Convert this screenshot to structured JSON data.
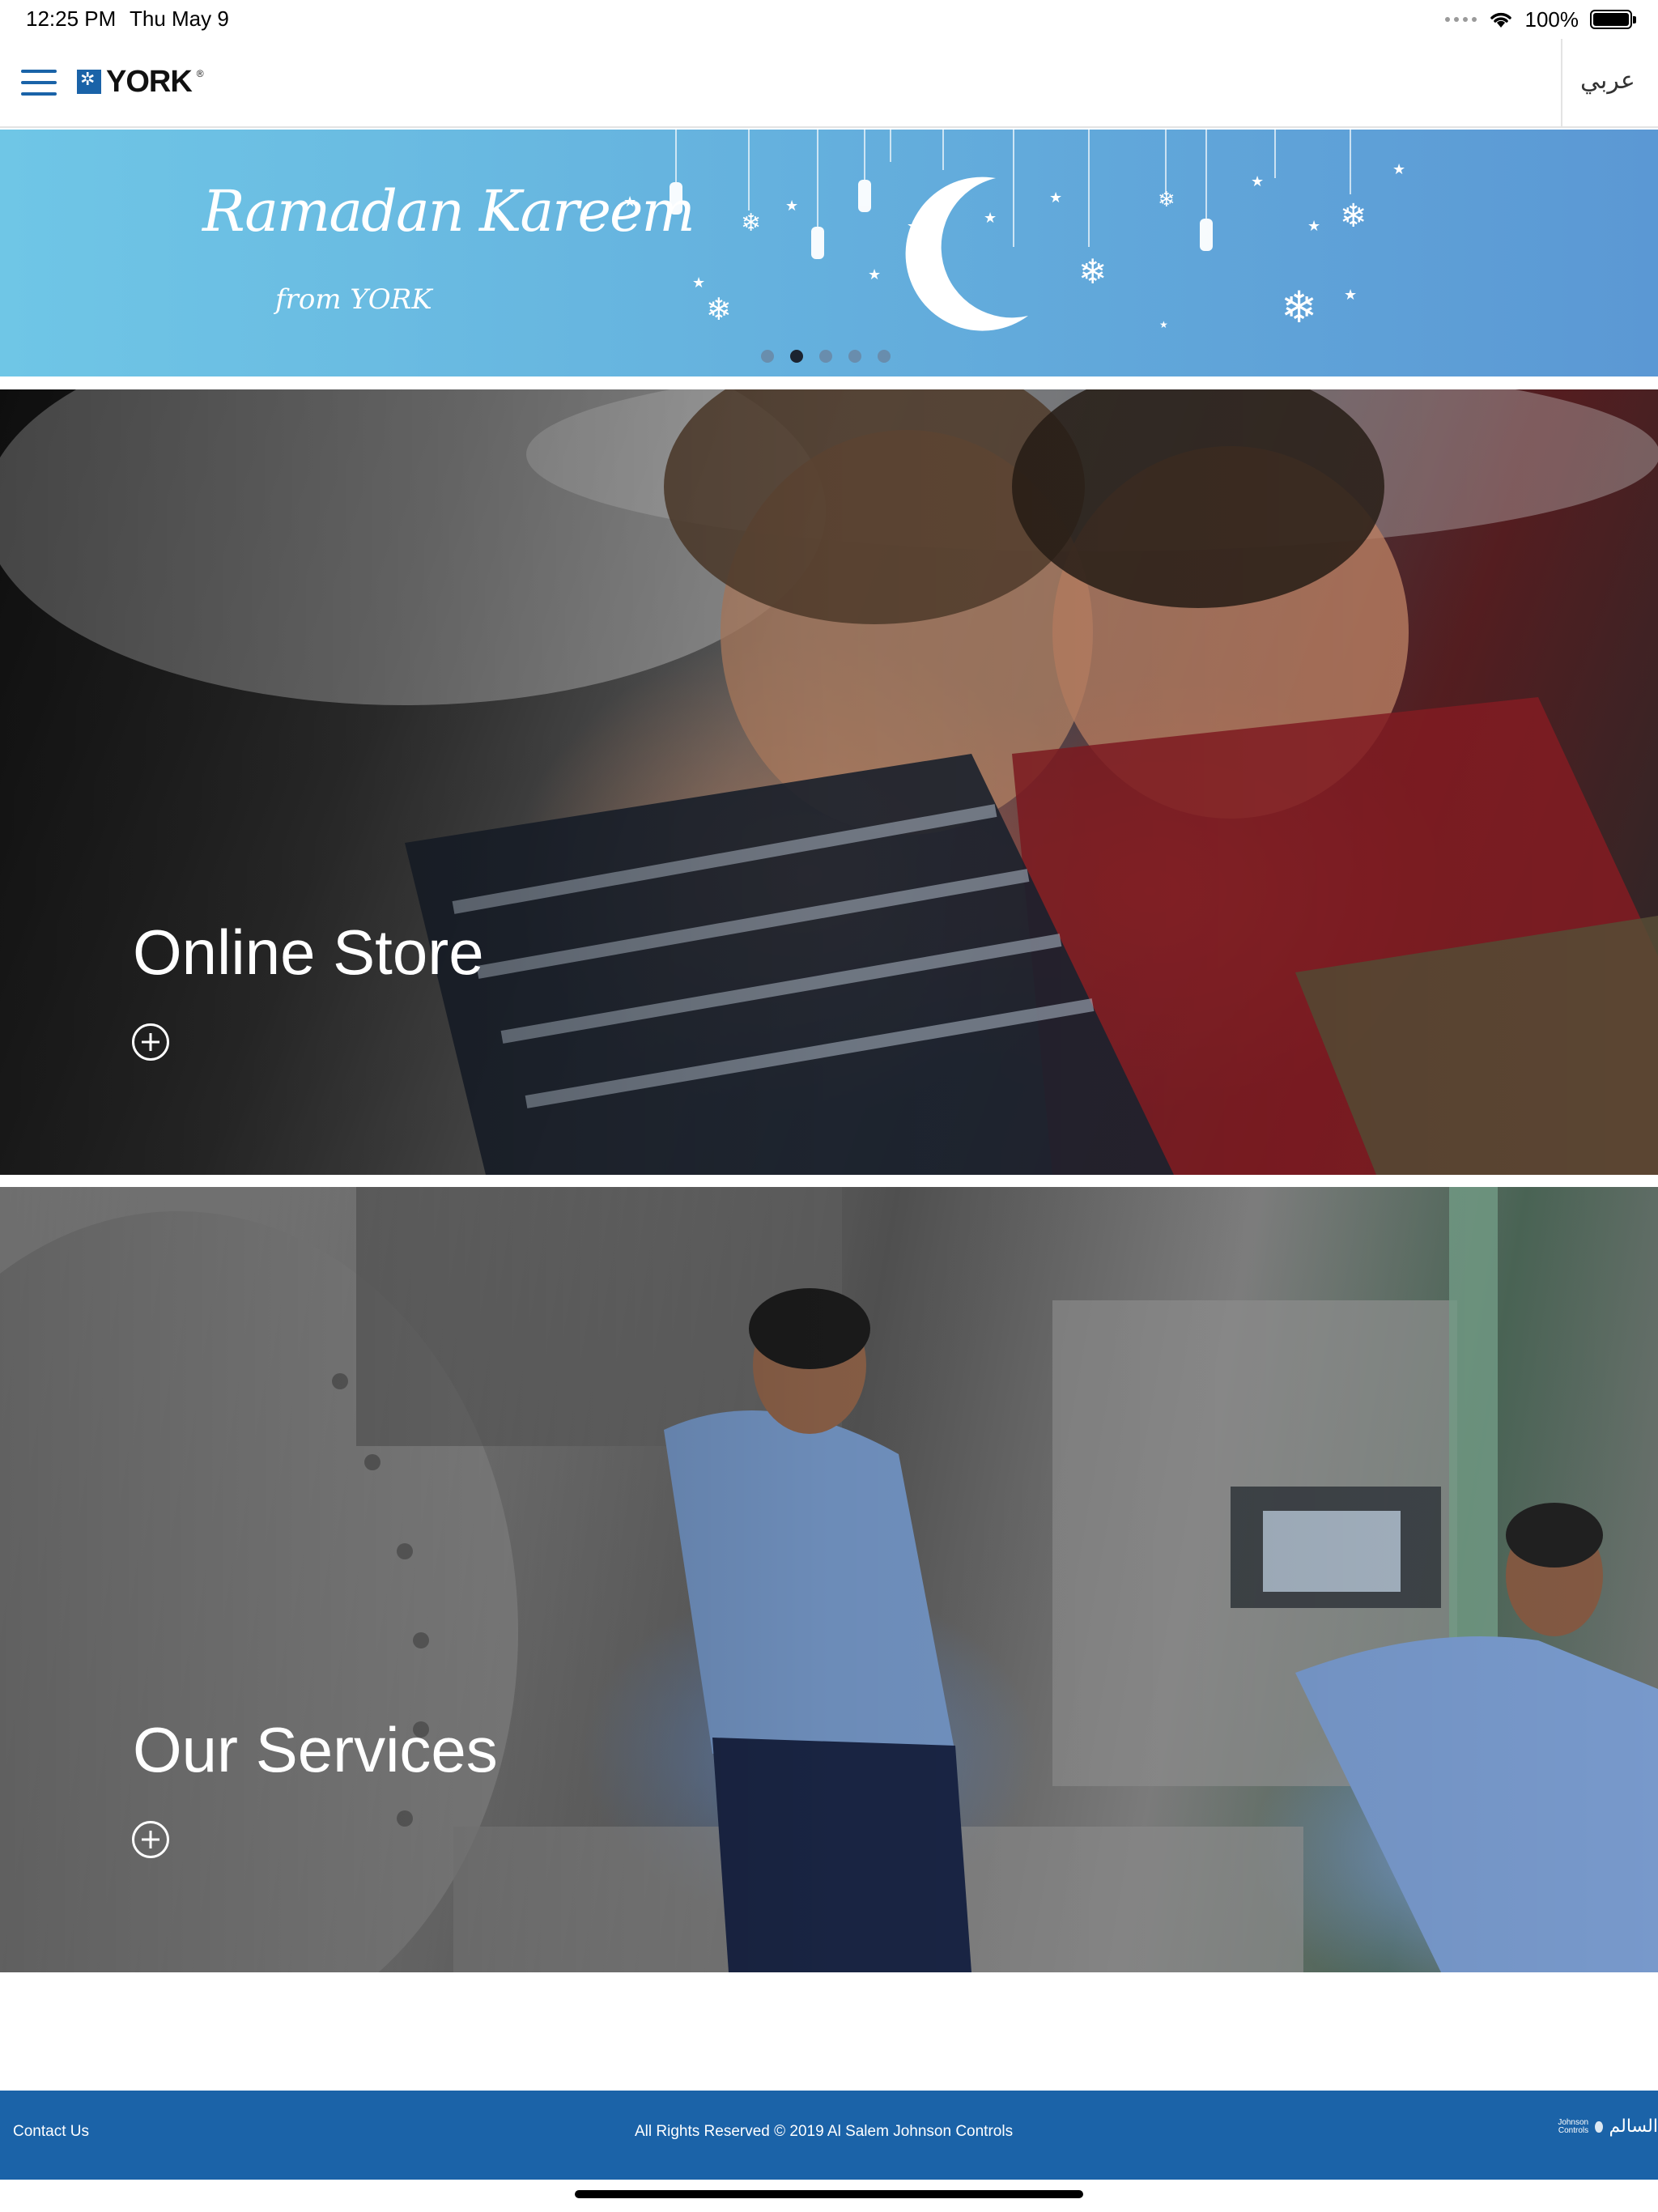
{
  "status_bar": {
    "time": "12:25 PM",
    "date": "Thu May 9",
    "battery": "100%",
    "icons": [
      "signal-dots-icon",
      "wifi-icon",
      "battery-icon"
    ]
  },
  "header": {
    "menu_icon": "hamburger-menu-icon",
    "logo_text": "YORK",
    "logo_mark": "®",
    "language_toggle": "عربي"
  },
  "banner": {
    "title": "Ramadan Kareem",
    "subtitle": "from YORK",
    "slide_count": 5,
    "active_slide": 2
  },
  "tiles": [
    {
      "title": "Online Store",
      "action_icon": "plus-circle-icon"
    },
    {
      "title": "Our Services",
      "action_icon": "plus-circle-icon"
    }
  ],
  "footer": {
    "contact_label": "Contact Us",
    "copyright": "All Rights Reserved © 2019 Al Salem Johnson Controls",
    "partner_logo_en": "Johnson Controls",
    "partner_logo_ar": "السالم"
  },
  "colors": {
    "brand_blue": "#1b63a8",
    "banner_light": "#6fc6e6",
    "banner_dark": "#5b98d4"
  }
}
